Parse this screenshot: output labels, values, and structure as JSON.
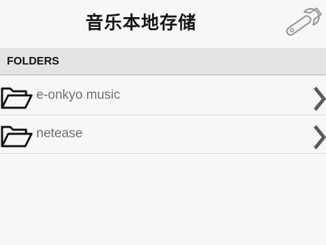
{
  "header": {
    "title": "音乐本地存储",
    "settings_icon": "wrench-icon"
  },
  "section": {
    "label": "FOLDERS"
  },
  "folders": [
    {
      "label": "e-onkyo music",
      "icon": "folder-icon"
    },
    {
      "label": "netease",
      "icon": "folder-icon"
    }
  ],
  "colors": {
    "background": "#f7f7f7",
    "section_bg": "#e4e4e4",
    "item_text": "#6f6f6f",
    "title_text": "#151515"
  }
}
